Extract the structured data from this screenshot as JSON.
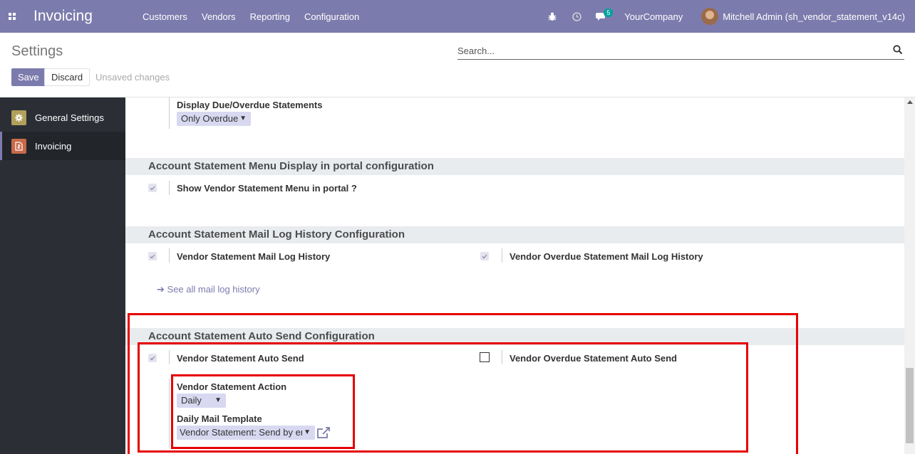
{
  "navbar": {
    "app_title": "Invoicing",
    "menu": [
      "Customers",
      "Vendors",
      "Reporting",
      "Configuration"
    ],
    "chat_badge": "5",
    "company": "YourCompany",
    "user": "Mitchell Admin (sh_vendor_statement_v14c)"
  },
  "control": {
    "title": "Settings",
    "search_placeholder": "Search...",
    "save_label": "Save",
    "discard_label": "Discard",
    "unsaved_label": "Unsaved changes"
  },
  "sidebar": {
    "items": [
      {
        "label": "General Settings",
        "icon": "gear-icon",
        "color": "#b0a05a"
      },
      {
        "label": "Invoicing",
        "icon": "invoice-icon",
        "color": "#c8694a"
      }
    ]
  },
  "main": {
    "due_overdue": {
      "label": "Display Due/Overdue Statements",
      "value": "Only Overdue"
    },
    "portal_section": {
      "title": "Account Statement Menu Display in portal configuration",
      "option": "Show Vendor Statement Menu in portal ?",
      "checked": true
    },
    "mail_log_section": {
      "title": "Account Statement Mail Log History Configuration",
      "left_option": "Vendor Statement Mail Log History",
      "left_checked": true,
      "right_option": "Vendor Overdue Statement Mail Log History",
      "right_checked": true,
      "link": "See all mail log history"
    },
    "auto_send_section": {
      "title": "Account Statement Auto Send Configuration",
      "left_option": "Vendor Statement Auto Send",
      "left_checked": true,
      "right_option": "Vendor Overdue Statement Auto Send",
      "right_checked": false,
      "action_label": "Vendor Statement Action",
      "action_value": "Daily",
      "template_label": "Daily Mail Template",
      "template_value": "Vendor Statement: Send by en"
    }
  },
  "colors": {
    "brand": "#7c7bad",
    "highlight": "#e60000"
  }
}
